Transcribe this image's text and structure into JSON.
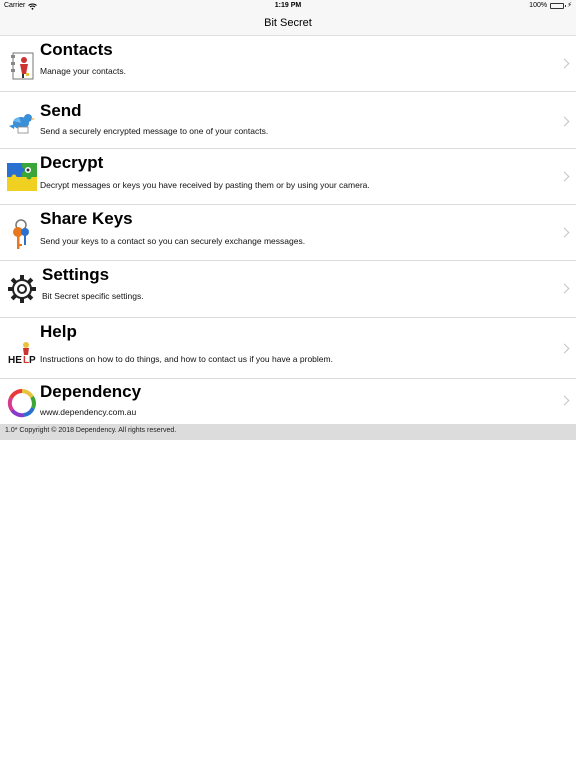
{
  "status_bar": {
    "carrier": "Carrier",
    "time": "1:19 PM",
    "battery": "100%",
    "battery_level": 1.0
  },
  "nav": {
    "title": "Bit Secret"
  },
  "menu": [
    {
      "title": "Contacts",
      "subtitle": "Manage your contacts.",
      "icon": "contacts-book-icon"
    },
    {
      "title": "Send",
      "subtitle": "Send a securely encrypted message to one of your contacts.",
      "icon": "bird-icon"
    },
    {
      "title": "Decrypt",
      "subtitle": "Decrypt messages or keys you have received by pasting them or by using your camera.",
      "icon": "puzzle-icon"
    },
    {
      "title": "Share Keys",
      "subtitle": "Send your keys to a contact so you can securely exchange messages.",
      "icon": "keys-icon"
    },
    {
      "title": "Settings",
      "subtitle": "Bit Secret specific settings.",
      "icon": "gear-icon"
    },
    {
      "title": "Help",
      "subtitle": "Instructions on how to do things, and how to contact us if you have a problem.",
      "icon": "help-icon"
    },
    {
      "title": "Dependency",
      "subtitle": "www.dependency.com.au",
      "icon": "ring-logo-icon"
    }
  ],
  "footer": {
    "text": "1.0* Copyright © 2018 Dependency. All rights reserved."
  },
  "colors": {
    "battery": "#4cd964",
    "footer_bg": "#dcdcdc",
    "chevron": "#c4c4c6"
  }
}
